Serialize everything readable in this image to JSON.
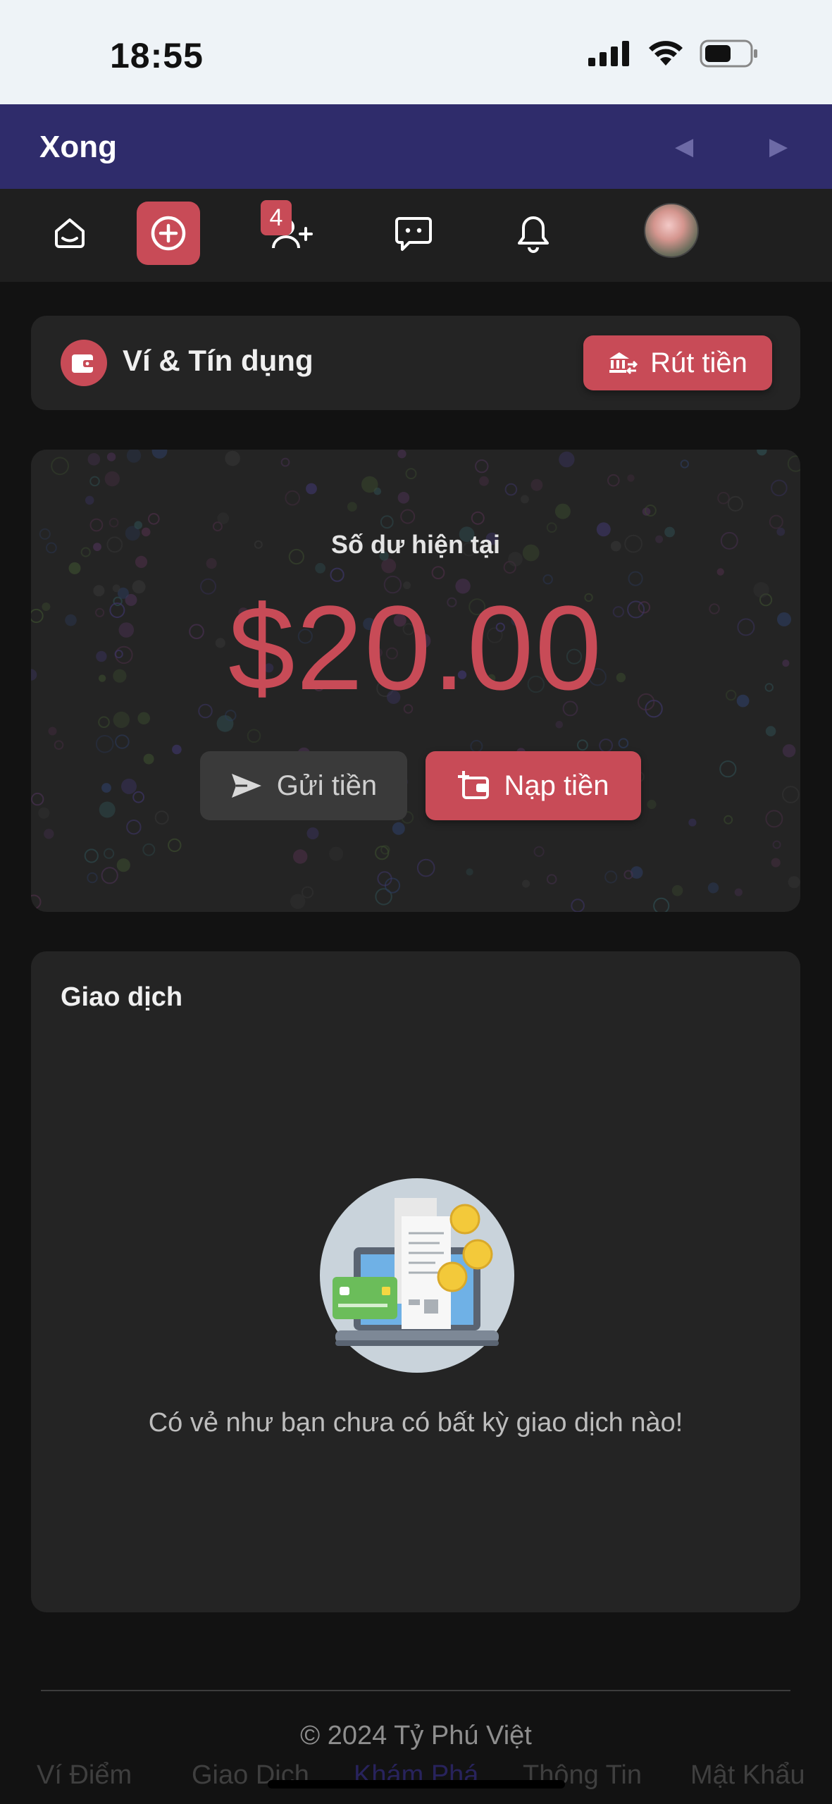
{
  "status_bar": {
    "time": "18:55"
  },
  "browser_bar": {
    "done_label": "Xong",
    "prev_icon": "◀",
    "next_icon": "▶"
  },
  "nav": {
    "items": [
      {
        "icon": "home-icon"
      },
      {
        "icon": "plus-circle-icon",
        "active": true
      },
      {
        "icon": "add-user-icon",
        "badge": "4"
      },
      {
        "icon": "chat-icon"
      },
      {
        "icon": "bell-icon"
      },
      {
        "icon": "avatar"
      }
    ],
    "friend_requests_badge": "4"
  },
  "wallet": {
    "title": "Ví & Tín dụng",
    "withdraw_label": "Rút tiền"
  },
  "balance": {
    "label": "Số dư hiện tại",
    "amount": "$20.00",
    "send_label": "Gửi tiền",
    "topup_label": "Nạp tiền"
  },
  "transactions": {
    "title": "Giao dịch",
    "empty_message": "Có vẻ như bạn chưa có bất kỳ giao dịch nào!"
  },
  "footer": {
    "copyright": "© 2024 Tỷ Phú Việt"
  },
  "bottom_tabs": [
    {
      "label": "Ví Điểm"
    },
    {
      "label": "Giao Dịch"
    },
    {
      "label": "Khám Phá",
      "active": true
    },
    {
      "label": "Thông Tin"
    },
    {
      "label": "Mật Khẩu"
    }
  ],
  "colors": {
    "accent": "#c84b57",
    "background": "#121212",
    "card": "#242424",
    "done_bar": "#2f2c6b"
  }
}
